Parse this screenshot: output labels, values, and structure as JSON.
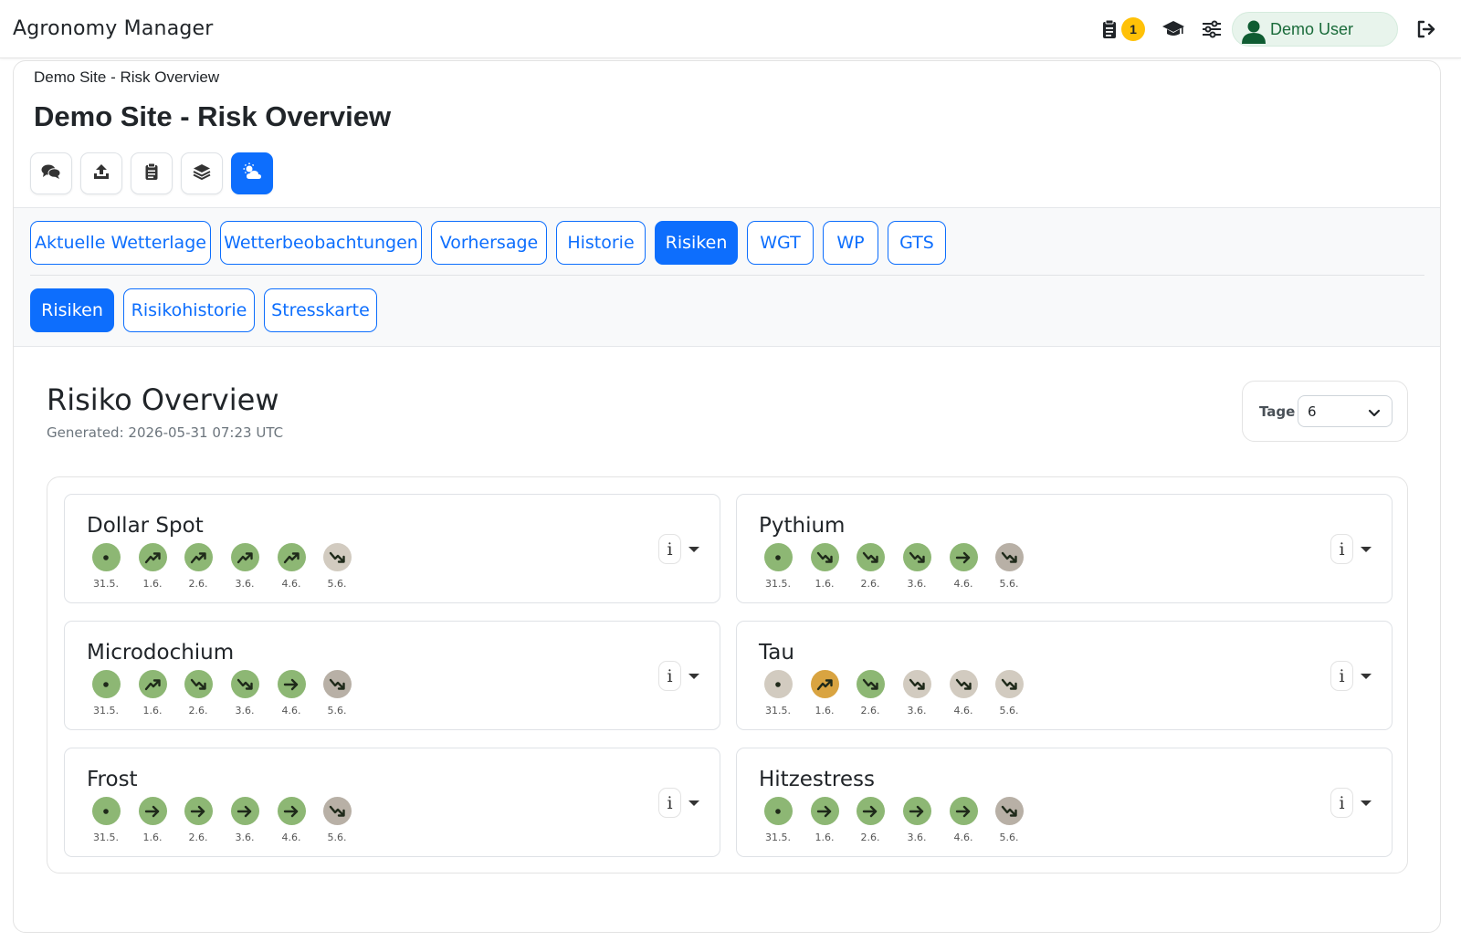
{
  "app": {
    "title": "Agronomy Manager"
  },
  "nav": {
    "badge_count": "1",
    "user_name": "Demo User"
  },
  "page": {
    "breadcrumb": "Demo Site - Risk Overview",
    "title": "Demo Site - Risk Overview"
  },
  "toolbar": [
    "chat-icon",
    "upload-icon",
    "clipboard-icon",
    "layers-icon",
    "weather-icon"
  ],
  "tabs": [
    {
      "label": "Aktuelle Wetterlage",
      "active": false
    },
    {
      "label": "Wetterbeobachtungen",
      "active": false
    },
    {
      "label": "Vorhersage",
      "active": false
    },
    {
      "label": "Historie",
      "active": false
    },
    {
      "label": "Risiken",
      "active": true
    },
    {
      "label": "WGT",
      "active": false
    },
    {
      "label": "WP",
      "active": false
    },
    {
      "label": "GTS",
      "active": false
    }
  ],
  "subtabs": [
    {
      "label": "Risiken",
      "active": true
    },
    {
      "label": "Risikohistorie",
      "active": false
    },
    {
      "label": "Stresskarte",
      "active": false
    }
  ],
  "section": {
    "title": "Risiko Overview",
    "generated": "Generated: 2026-05-31 07:23 UTC",
    "tage_label": "Tage",
    "tage_value": "6"
  },
  "colors": {
    "primary": "#0d6efd",
    "green": "#8db774",
    "gray": "#d2cbc0",
    "gray_dark": "#b8b0a6",
    "orange": "#d9a441"
  },
  "risks": [
    {
      "name": "Dollar Spot",
      "days": [
        {
          "date": "31.5.",
          "trend": "dot",
          "level": "green"
        },
        {
          "date": "1.6.",
          "trend": "up",
          "level": "green"
        },
        {
          "date": "2.6.",
          "trend": "up",
          "level": "green"
        },
        {
          "date": "3.6.",
          "trend": "up",
          "level": "green"
        },
        {
          "date": "4.6.",
          "trend": "up",
          "level": "green"
        },
        {
          "date": "5.6.",
          "trend": "down",
          "level": "gray"
        }
      ]
    },
    {
      "name": "Pythium",
      "days": [
        {
          "date": "31.5.",
          "trend": "dot",
          "level": "green"
        },
        {
          "date": "1.6.",
          "trend": "down",
          "level": "green"
        },
        {
          "date": "2.6.",
          "trend": "down",
          "level": "green"
        },
        {
          "date": "3.6.",
          "trend": "down",
          "level": "green"
        },
        {
          "date": "4.6.",
          "trend": "right",
          "level": "green"
        },
        {
          "date": "5.6.",
          "trend": "down",
          "level": "gray_dark"
        }
      ]
    },
    {
      "name": "Microdochium",
      "days": [
        {
          "date": "31.5.",
          "trend": "dot",
          "level": "green"
        },
        {
          "date": "1.6.",
          "trend": "up",
          "level": "green"
        },
        {
          "date": "2.6.",
          "trend": "down",
          "level": "green"
        },
        {
          "date": "3.6.",
          "trend": "down",
          "level": "green"
        },
        {
          "date": "4.6.",
          "trend": "right",
          "level": "green"
        },
        {
          "date": "5.6.",
          "trend": "down",
          "level": "gray_dark"
        }
      ]
    },
    {
      "name": "Tau",
      "days": [
        {
          "date": "31.5.",
          "trend": "dot",
          "level": "gray"
        },
        {
          "date": "1.6.",
          "trend": "up",
          "level": "orange"
        },
        {
          "date": "2.6.",
          "trend": "down",
          "level": "green"
        },
        {
          "date": "3.6.",
          "trend": "down",
          "level": "gray"
        },
        {
          "date": "4.6.",
          "trend": "down",
          "level": "gray"
        },
        {
          "date": "5.6.",
          "trend": "down",
          "level": "gray"
        }
      ]
    },
    {
      "name": "Frost",
      "days": [
        {
          "date": "31.5.",
          "trend": "dot",
          "level": "green"
        },
        {
          "date": "1.6.",
          "trend": "right",
          "level": "green"
        },
        {
          "date": "2.6.",
          "trend": "right",
          "level": "green"
        },
        {
          "date": "3.6.",
          "trend": "right",
          "level": "green"
        },
        {
          "date": "4.6.",
          "trend": "right",
          "level": "green"
        },
        {
          "date": "5.6.",
          "trend": "down",
          "level": "gray_dark"
        }
      ]
    },
    {
      "name": "Hitzestress",
      "days": [
        {
          "date": "31.5.",
          "trend": "dot",
          "level": "green"
        },
        {
          "date": "1.6.",
          "trend": "right",
          "level": "green"
        },
        {
          "date": "2.6.",
          "trend": "right",
          "level": "green"
        },
        {
          "date": "3.6.",
          "trend": "right",
          "level": "green"
        },
        {
          "date": "4.6.",
          "trend": "right",
          "level": "green"
        },
        {
          "date": "5.6.",
          "trend": "down",
          "level": "gray_dark"
        }
      ]
    }
  ]
}
